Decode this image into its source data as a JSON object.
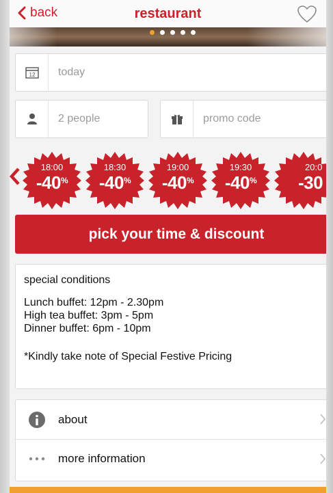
{
  "header": {
    "back_label": "back",
    "title": "restaurant"
  },
  "carousel": {
    "page_count": 5,
    "active_index": 0
  },
  "form": {
    "date": {
      "value": "today",
      "icon": "calendar-icon",
      "calendar_day": "12"
    },
    "people": {
      "value": "2 people",
      "icon": "person-icon"
    },
    "promo": {
      "placeholder": "promo code",
      "icon": "gift-icon"
    }
  },
  "time_slots": [
    {
      "time": "18:00",
      "discount": "-40",
      "pct": "%"
    },
    {
      "time": "18:30",
      "discount": "-40",
      "pct": "%"
    },
    {
      "time": "19:00",
      "discount": "-40",
      "pct": "%"
    },
    {
      "time": "19:30",
      "discount": "-40",
      "pct": "%"
    },
    {
      "time": "20:0",
      "discount": "-30",
      "pct": ""
    }
  ],
  "cta": {
    "label": "pick your time & discount"
  },
  "conditions": {
    "title": "special conditions",
    "lines": [
      "Lunch buffet: 12pm - 2.30pm",
      "High tea buffet: 3pm - 5pm",
      "Dinner buffet: 6pm - 10pm"
    ],
    "note": "*Kindly take note of Special Festive Pricing"
  },
  "info_list": [
    {
      "label": "about",
      "icon": "info-icon"
    },
    {
      "label": "more information",
      "icon": "ellipsis-icon"
    }
  ],
  "colors": {
    "brand_red": "#c8222a",
    "accent_orange": "#f0a030"
  }
}
